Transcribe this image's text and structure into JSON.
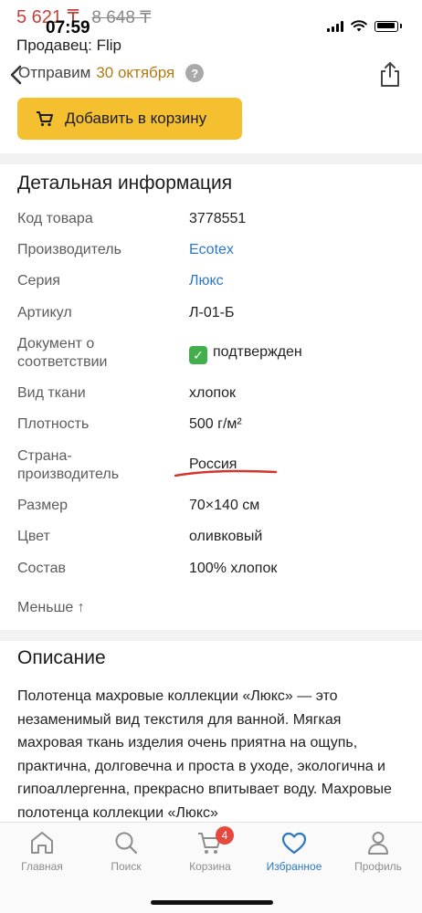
{
  "status_bar": {
    "time": "07:59"
  },
  "product": {
    "price": "5 621 ₸",
    "old_price": "8 648 ₸",
    "seller": "Продавец: Flip",
    "ship_prefix": "Отправим",
    "ship_date": "30 октября",
    "help_glyph": "?",
    "add_to_cart": "Добавить в корзину"
  },
  "details": {
    "title": "Детальная информация",
    "rows": [
      {
        "key": "Код товара",
        "value": "3778551"
      },
      {
        "key": "Производитель",
        "value": "Ecotex"
      },
      {
        "key": "Серия",
        "value": "Люкс"
      },
      {
        "key": "Артикул",
        "value": "Л-01-Б"
      },
      {
        "key": "Документ о соответствии",
        "value": "подтвержден"
      },
      {
        "key": "Вид ткани",
        "value": "хлопок"
      },
      {
        "key": "Плотность",
        "value": "500 г/м²"
      },
      {
        "key": "Страна-производитель",
        "value": "Россия"
      },
      {
        "key": "Размер",
        "value": "70×140 см"
      },
      {
        "key": "Цвет",
        "value": "оливковый"
      },
      {
        "key": "Состав",
        "value": "100% хлопок"
      }
    ],
    "less": "Меньше ↑"
  },
  "description": {
    "title": "Описание",
    "text": "Полотенца махровые коллекции «Люкс» — это незаменимый вид текстиля для ванной. Мягкая махровая ткань изделия очень приятна на ощупь, практична, долговечна и проста в уходе, экологична и гипоаллергенна, прекрасно впитывает воду. Махровые полотенца коллекции «Люкс»"
  },
  "tabs": [
    {
      "label": "Главная",
      "icon": "home-icon"
    },
    {
      "label": "Поиск",
      "icon": "search-icon"
    },
    {
      "label": "Корзина",
      "icon": "cart-icon",
      "badge": "4"
    },
    {
      "label": "Избранное",
      "icon": "heart-icon",
      "active": true
    },
    {
      "label": "Профиль",
      "icon": "profile-icon"
    }
  ],
  "colors": {
    "accent_yellow": "#f4c02f",
    "link_blue": "#2b78c5",
    "price_red": "#c0433c",
    "badge_red": "#e5483f",
    "ship_date_orange": "#b27a12"
  }
}
